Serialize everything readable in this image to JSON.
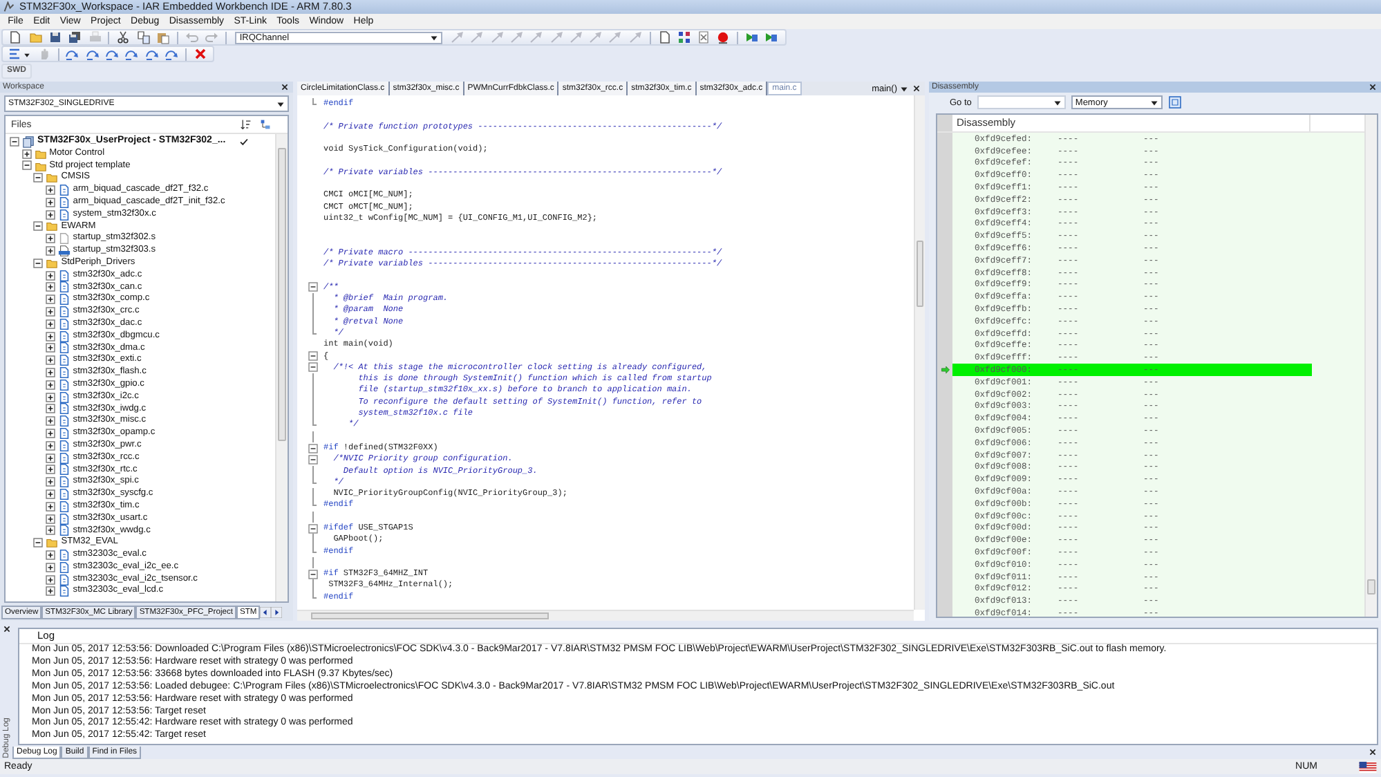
{
  "window": {
    "title": "STM32F30x_Workspace - IAR Embedded Workbench IDE - ARM 7.80.3"
  },
  "menu": [
    "File",
    "Edit",
    "View",
    "Project",
    "Debug",
    "Disassembly",
    "ST-Link",
    "Tools",
    "Window",
    "Help"
  ],
  "toolbar_1": [
    {
      "kind": "button",
      "disabled": false
    },
    {
      "kind": "button",
      "disabled": false
    },
    {
      "kind": "button",
      "disabled": false
    },
    {
      "kind": "button",
      "disabled": false
    },
    {
      "kind": "button",
      "disabled": true
    },
    {
      "kind": "separator"
    },
    {
      "kind": "button",
      "disabled": false
    },
    {
      "kind": "button",
      "disabled": false
    },
    {
      "kind": "button",
      "disabled": false
    },
    {
      "kind": "separator"
    },
    {
      "kind": "button",
      "disabled": true
    },
    {
      "kind": "button",
      "disabled": true
    },
    {
      "kind": "separator"
    },
    {
      "kind": "combo",
      "value": "IRQChannel"
    },
    {
      "kind": "button",
      "disabled": true
    },
    {
      "kind": "button",
      "disabled": true
    },
    {
      "kind": "button",
      "disabled": true
    },
    {
      "kind": "button",
      "disabled": true
    },
    {
      "kind": "button",
      "disabled": true
    },
    {
      "kind": "button",
      "disabled": true
    },
    {
      "kind": "button",
      "disabled": true
    },
    {
      "kind": "button",
      "disabled": true
    },
    {
      "kind": "button",
      "disabled": true
    },
    {
      "kind": "button",
      "disabled": true
    },
    {
      "kind": "separator"
    },
    {
      "kind": "button",
      "disabled": false
    },
    {
      "kind": "button",
      "disabled": false
    },
    {
      "kind": "button",
      "disabled": false
    },
    {
      "kind": "button",
      "disabled": false
    },
    {
      "kind": "separator"
    },
    {
      "kind": "button",
      "disabled": false
    },
    {
      "kind": "button",
      "disabled": false
    }
  ],
  "toolbar_2": [
    {
      "kind": "button",
      "disabled": false
    },
    {
      "kind": "button",
      "disabled": true
    },
    {
      "kind": "separator"
    },
    {
      "kind": "button",
      "disabled": false
    },
    {
      "kind": "button",
      "disabled": false
    },
    {
      "kind": "button",
      "disabled": false
    },
    {
      "kind": "button",
      "disabled": false
    },
    {
      "kind": "button",
      "disabled": false
    },
    {
      "kind": "button",
      "disabled": false
    },
    {
      "kind": "separator"
    },
    {
      "kind": "button",
      "disabled": false
    }
  ],
  "toolbar_3": {
    "label": "SWD"
  },
  "workspace": {
    "title": "Workspace",
    "configuration": "STM32F302_SINGLEDRIVE",
    "files_header": "Files",
    "tree": [
      {
        "label": "STM32F30x_UserProject - STM32F302_...",
        "kind": "project",
        "expanded": true,
        "active": true,
        "children": [
          {
            "label": "Motor Control",
            "kind": "folder",
            "expanded": false
          },
          {
            "label": "Std project template",
            "kind": "folder",
            "expanded": true,
            "children": [
              {
                "label": "CMSIS",
                "kind": "folder",
                "expanded": true,
                "children": [
                  {
                    "label": "arm_biquad_cascade_df2T_f32.c",
                    "kind": "c-file",
                    "expanded": false
                  },
                  {
                    "label": "arm_biquad_cascade_df2T_init_f32.c",
                    "kind": "c-file",
                    "expanded": false
                  },
                  {
                    "label": "system_stm32f30x.c",
                    "kind": "c-file",
                    "expanded": false
                  }
                ]
              },
              {
                "label": "EWARM",
                "kind": "folder",
                "expanded": true,
                "children": [
                  {
                    "label": "startup_stm32f302.s",
                    "kind": "excluded-file",
                    "expanded": false
                  },
                  {
                    "label": "startup_stm32f303.s",
                    "kind": "asm-file",
                    "expanded": false
                  }
                ]
              },
              {
                "label": "StdPeriph_Drivers",
                "kind": "folder",
                "expanded": true,
                "children": [
                  {
                    "label": "stm32f30x_adc.c",
                    "kind": "c-file",
                    "expanded": false
                  },
                  {
                    "label": "stm32f30x_can.c",
                    "kind": "c-file",
                    "expanded": false
                  },
                  {
                    "label": "stm32f30x_comp.c",
                    "kind": "c-file",
                    "expanded": false
                  },
                  {
                    "label": "stm32f30x_crc.c",
                    "kind": "c-file",
                    "expanded": false
                  },
                  {
                    "label": "stm32f30x_dac.c",
                    "kind": "c-file",
                    "expanded": false
                  },
                  {
                    "label": "stm32f30x_dbgmcu.c",
                    "kind": "c-file",
                    "expanded": false
                  },
                  {
                    "label": "stm32f30x_dma.c",
                    "kind": "c-file",
                    "expanded": false
                  },
                  {
                    "label": "stm32f30x_exti.c",
                    "kind": "c-file",
                    "expanded": false
                  },
                  {
                    "label": "stm32f30x_flash.c",
                    "kind": "c-file",
                    "expanded": false
                  },
                  {
                    "label": "stm32f30x_gpio.c",
                    "kind": "c-file",
                    "expanded": false
                  },
                  {
                    "label": "stm32f30x_i2c.c",
                    "kind": "c-file",
                    "expanded": false
                  },
                  {
                    "label": "stm32f30x_iwdg.c",
                    "kind": "c-file",
                    "expanded": false
                  },
                  {
                    "label": "stm32f30x_misc.c",
                    "kind": "c-file",
                    "expanded": false
                  },
                  {
                    "label": "stm32f30x_opamp.c",
                    "kind": "c-file",
                    "expanded": false
                  },
                  {
                    "label": "stm32f30x_pwr.c",
                    "kind": "c-file",
                    "expanded": false
                  },
                  {
                    "label": "stm32f30x_rcc.c",
                    "kind": "c-file",
                    "expanded": false
                  },
                  {
                    "label": "stm32f30x_rtc.c",
                    "kind": "c-file",
                    "expanded": false
                  },
                  {
                    "label": "stm32f30x_spi.c",
                    "kind": "c-file",
                    "expanded": false
                  },
                  {
                    "label": "stm32f30x_syscfg.c",
                    "kind": "c-file",
                    "expanded": false
                  },
                  {
                    "label": "stm32f30x_tim.c",
                    "kind": "c-file",
                    "expanded": false
                  },
                  {
                    "label": "stm32f30x_usart.c",
                    "kind": "c-file",
                    "expanded": false
                  },
                  {
                    "label": "stm32f30x_wwdg.c",
                    "kind": "c-file",
                    "expanded": false
                  }
                ]
              },
              {
                "label": "STM32_EVAL",
                "kind": "folder",
                "expanded": true,
                "children": [
                  {
                    "label": "stm32303c_eval.c",
                    "kind": "c-file",
                    "expanded": false
                  },
                  {
                    "label": "stm32303c_eval_i2c_ee.c",
                    "kind": "c-file",
                    "expanded": false
                  },
                  {
                    "label": "stm32303c_eval_i2c_tsensor.c",
                    "kind": "c-file",
                    "expanded": false
                  },
                  {
                    "label": "stm32303c_eval_lcd.c",
                    "kind": "c-file",
                    "expanded": false
                  }
                ]
              }
            ]
          }
        ]
      }
    ],
    "tabs": [
      {
        "label": "Overview",
        "selected": false
      },
      {
        "label": "STM32F30x_MC Library",
        "selected": false
      },
      {
        "label": "STM32F30x_PFC_Project",
        "selected": false
      },
      {
        "label": "STM",
        "selected": true
      }
    ]
  },
  "editor": {
    "tabs": [
      {
        "label": "CircleLimitationClass.c",
        "selected": false
      },
      {
        "label": "stm32f30x_misc.c",
        "selected": false
      },
      {
        "label": "PWMnCurrFdbkClass.c",
        "selected": false
      },
      {
        "label": "stm32f30x_rcc.c",
        "selected": false
      },
      {
        "label": "stm32f30x_tim.c",
        "selected": false
      },
      {
        "label": "stm32f30x_adc.c",
        "selected": false
      },
      {
        "label": "main.c",
        "selected": true
      }
    ],
    "function": "main()",
    "lines": [
      {
        "kind": "directive",
        "keyword": "#endif",
        "gutter": {
          "kind": "fold-end"
        }
      },
      {
        "kind": "blank"
      },
      {
        "kind": "comment",
        "text": "/* Private function prototypes -----------------------------------------------*/"
      },
      {
        "kind": "blank"
      },
      {
        "kind": "code",
        "text": "void SysTick_Configuration(void);"
      },
      {
        "kind": "blank"
      },
      {
        "kind": "comment",
        "text": "/* Private variables ---------------------------------------------------------*/"
      },
      {
        "kind": "blank"
      },
      {
        "kind": "code",
        "text": "CMCI oMCI[MC_NUM];"
      },
      {
        "kind": "code",
        "text": "CMCT oMCT[MC_NUM];"
      },
      {
        "kind": "code",
        "text": "uint32_t wConfig[MC_NUM] = {UI_CONFIG_M1,UI_CONFIG_M2};"
      },
      {
        "kind": "blank"
      },
      {
        "kind": "blank"
      },
      {
        "kind": "comment",
        "text": "/* Private macro -------------------------------------------------------------*/"
      },
      {
        "kind": "comment",
        "text": "/* Private variables ---------------------------------------------------------*/"
      },
      {
        "kind": "blank"
      },
      {
        "kind": "comment",
        "text": "/**",
        "gutter": {
          "kind": "fold-start"
        }
      },
      {
        "kind": "comment",
        "text": "  * @brief  Main program.",
        "gutter": {
          "kind": "fold-inside"
        }
      },
      {
        "kind": "comment",
        "text": "  * @param  None",
        "gutter": {
          "kind": "fold-inside"
        }
      },
      {
        "kind": "comment",
        "text": "  * @retval None",
        "gutter": {
          "kind": "fold-inside"
        }
      },
      {
        "kind": "comment",
        "text": "  */",
        "gutter": {
          "kind": "fold-end"
        }
      },
      {
        "kind": "code",
        "text": "int main(void)"
      },
      {
        "kind": "code",
        "text": "{",
        "gutter": {
          "kind": "fold-start"
        }
      },
      {
        "kind": "comment",
        "text": "  /*!< At this stage the microcontroller clock setting is already configured,",
        "gutter": {
          "kind": "fold-start"
        }
      },
      {
        "kind": "comment",
        "text": "       this is done through SystemInit() function which is called from startup",
        "gutter": {
          "kind": "fold-inside"
        }
      },
      {
        "kind": "comment",
        "text": "       file (startup_stm32f10x_xx.s) before to branch to application main.",
        "gutter": {
          "kind": "fold-inside"
        }
      },
      {
        "kind": "comment",
        "text": "       To reconfigure the default setting of SystemInit() function, refer to",
        "gutter": {
          "kind": "fold-inside"
        }
      },
      {
        "kind": "comment",
        "text": "       system_stm32f10x.c file",
        "gutter": {
          "kind": "fold-inside"
        }
      },
      {
        "kind": "comment",
        "text": "     */",
        "gutter": {
          "kind": "fold-end"
        }
      },
      {
        "kind": "blank",
        "gutter": {
          "kind": "fold-inside"
        }
      },
      {
        "kind": "directive",
        "keyword": "#if",
        "text": " !defined(STM32F0XX)",
        "gutter": {
          "kind": "fold-start"
        }
      },
      {
        "kind": "comment",
        "text": "  /*NVIC Priority group configuration.",
        "gutter": {
          "kind": "fold-start"
        }
      },
      {
        "kind": "comment",
        "text": "    Default option is NVIC_PriorityGroup_3.",
        "gutter": {
          "kind": "fold-inside"
        }
      },
      {
        "kind": "comment",
        "text": "  */",
        "gutter": {
          "kind": "fold-end"
        }
      },
      {
        "kind": "code",
        "text": "  NVIC_PriorityGroupConfig(NVIC_PriorityGroup_3);",
        "gutter": {
          "kind": "fold-inside"
        }
      },
      {
        "kind": "directive",
        "keyword": "#endif",
        "gutter": {
          "kind": "fold-end"
        }
      },
      {
        "kind": "blank",
        "gutter": {
          "kind": "fold-inside"
        }
      },
      {
        "kind": "directive",
        "keyword": "#ifdef",
        "text": " USE_STGAP1S",
        "gutter": {
          "kind": "fold-start"
        }
      },
      {
        "kind": "code",
        "text": "  GAPboot();",
        "gutter": {
          "kind": "fold-inside"
        }
      },
      {
        "kind": "directive",
        "keyword": "#endif",
        "gutter": {
          "kind": "fold-end"
        }
      },
      {
        "kind": "blank",
        "gutter": {
          "kind": "fold-inside"
        }
      },
      {
        "kind": "directive",
        "keyword": "#if",
        "text": " STM32F3_64MHZ_INT",
        "gutter": {
          "kind": "fold-start"
        }
      },
      {
        "kind": "code",
        "text": " STM32F3_64MHz_Internal();",
        "gutter": {
          "kind": "fold-inside"
        }
      },
      {
        "kind": "directive",
        "keyword": "#endif",
        "gutter": {
          "kind": "fold-end"
        }
      }
    ]
  },
  "disassembly": {
    "title": "Disassembly",
    "goto_label": "Go to",
    "memory": "Memory",
    "column_header": "Disassembly",
    "rows": [
      {
        "address": "0xfd9cefed:",
        "column_2": "----",
        "column_3": "---",
        "current": false
      },
      {
        "address": "0xfd9cefee:",
        "column_2": "----",
        "column_3": "---",
        "current": false
      },
      {
        "address": "0xfd9cefef:",
        "column_2": "----",
        "column_3": "---",
        "current": false
      },
      {
        "address": "0xfd9ceff0:",
        "column_2": "----",
        "column_3": "---",
        "current": false
      },
      {
        "address": "0xfd9ceff1:",
        "column_2": "----",
        "column_3": "---",
        "current": false
      },
      {
        "address": "0xfd9ceff2:",
        "column_2": "----",
        "column_3": "---",
        "current": false
      },
      {
        "address": "0xfd9ceff3:",
        "column_2": "----",
        "column_3": "---",
        "current": false
      },
      {
        "address": "0xfd9ceff4:",
        "column_2": "----",
        "column_3": "---",
        "current": false
      },
      {
        "address": "0xfd9ceff5:",
        "column_2": "----",
        "column_3": "---",
        "current": false
      },
      {
        "address": "0xfd9ceff6:",
        "column_2": "----",
        "column_3": "---",
        "current": false
      },
      {
        "address": "0xfd9ceff7:",
        "column_2": "----",
        "column_3": "---",
        "current": false
      },
      {
        "address": "0xfd9ceff8:",
        "column_2": "----",
        "column_3": "---",
        "current": false
      },
      {
        "address": "0xfd9ceff9:",
        "column_2": "----",
        "column_3": "---",
        "current": false
      },
      {
        "address": "0xfd9ceffa:",
        "column_2": "----",
        "column_3": "---",
        "current": false
      },
      {
        "address": "0xfd9ceffb:",
        "column_2": "----",
        "column_3": "---",
        "current": false
      },
      {
        "address": "0xfd9ceffc:",
        "column_2": "----",
        "column_3": "---",
        "current": false
      },
      {
        "address": "0xfd9ceffd:",
        "column_2": "----",
        "column_3": "---",
        "current": false
      },
      {
        "address": "0xfd9ceffe:",
        "column_2": "----",
        "column_3": "---",
        "current": false
      },
      {
        "address": "0xfd9cefff:",
        "column_2": "----",
        "column_3": "---",
        "current": false
      },
      {
        "address": "0xfd9cf000:",
        "column_2": "----",
        "column_3": "---",
        "current": true
      },
      {
        "address": "0xfd9cf001:",
        "column_2": "----",
        "column_3": "---",
        "current": false
      },
      {
        "address": "0xfd9cf002:",
        "column_2": "----",
        "column_3": "---",
        "current": false
      },
      {
        "address": "0xfd9cf003:",
        "column_2": "----",
        "column_3": "---",
        "current": false
      },
      {
        "address": "0xfd9cf004:",
        "column_2": "----",
        "column_3": "---",
        "current": false
      },
      {
        "address": "0xfd9cf005:",
        "column_2": "----",
        "column_3": "---",
        "current": false
      },
      {
        "address": "0xfd9cf006:",
        "column_2": "----",
        "column_3": "---",
        "current": false
      },
      {
        "address": "0xfd9cf007:",
        "column_2": "----",
        "column_3": "---",
        "current": false
      },
      {
        "address": "0xfd9cf008:",
        "column_2": "----",
        "column_3": "---",
        "current": false
      },
      {
        "address": "0xfd9cf009:",
        "column_2": "----",
        "column_3": "---",
        "current": false
      },
      {
        "address": "0xfd9cf00a:",
        "column_2": "----",
        "column_3": "---",
        "current": false
      },
      {
        "address": "0xfd9cf00b:",
        "column_2": "----",
        "column_3": "---",
        "current": false
      },
      {
        "address": "0xfd9cf00c:",
        "column_2": "----",
        "column_3": "---",
        "current": false
      },
      {
        "address": "0xfd9cf00d:",
        "column_2": "----",
        "column_3": "---",
        "current": false
      },
      {
        "address": "0xfd9cf00e:",
        "column_2": "----",
        "column_3": "---",
        "current": false
      },
      {
        "address": "0xfd9cf00f:",
        "column_2": "----",
        "column_3": "---",
        "current": false
      },
      {
        "address": "0xfd9cf010:",
        "column_2": "----",
        "column_3": "---",
        "current": false
      },
      {
        "address": "0xfd9cf011:",
        "column_2": "----",
        "column_3": "---",
        "current": false
      },
      {
        "address": "0xfd9cf012:",
        "column_2": "----",
        "column_3": "---",
        "current": false
      },
      {
        "address": "0xfd9cf013:",
        "column_2": "----",
        "column_3": "---",
        "current": false
      },
      {
        "address": "0xfd9cf014:",
        "column_2": "----",
        "column_3": "---",
        "current": false
      }
    ]
  },
  "log": {
    "side_label": "Debug Log",
    "header": "Log",
    "lines": [
      "Mon Jun 05, 2017 12:53:56: Downloaded C:\\Program Files (x86)\\STMicroelectronics\\FOC SDK\\v4.3.0 - Back9Mar2017 - V7.8IAR\\STM32 PMSM FOC LIB\\Web\\Project\\EWARM\\UserProject\\STM32F302_SINGLEDRIVE\\Exe\\STM32F303RB_SiC.out to flash memory.",
      "Mon Jun 05, 2017 12:53:56: Hardware reset with strategy 0 was performed",
      "Mon Jun 05, 2017 12:53:56: 33668 bytes downloaded into FLASH (9.37 Kbytes/sec)",
      "Mon Jun 05, 2017 12:53:56: Loaded debugee: C:\\Program Files (x86)\\STMicroelectronics\\FOC SDK\\v4.3.0 - Back9Mar2017 - V7.8IAR\\STM32 PMSM FOC LIB\\Web\\Project\\EWARM\\UserProject\\STM32F302_SINGLEDRIVE\\Exe\\STM32F303RB_SiC.out",
      "Mon Jun 05, 2017 12:53:56: Hardware reset with strategy 0 was performed",
      "Mon Jun 05, 2017 12:53:56: Target reset",
      "Mon Jun 05, 2017 12:55:42: Hardware reset with strategy 0 was performed",
      "Mon Jun 05, 2017 12:55:42: Target reset"
    ],
    "tabs": [
      {
        "label": "Debug Log",
        "selected": true
      },
      {
        "label": "Build",
        "selected": false
      },
      {
        "label": "Find in Files",
        "selected": false
      }
    ]
  },
  "status_bar": {
    "text": "Ready",
    "num": "NUM"
  }
}
